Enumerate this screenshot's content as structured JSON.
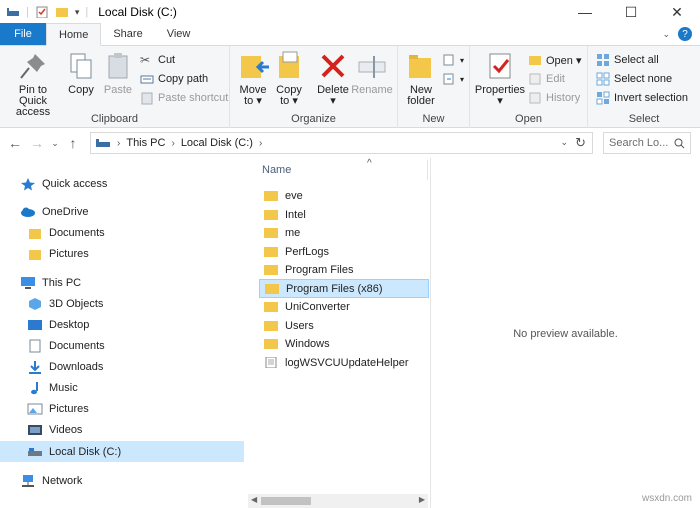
{
  "window": {
    "title": "Local Disk (C:)",
    "controls": {
      "minimize": "—",
      "maximize": "☐",
      "close": "✕"
    }
  },
  "tabs": {
    "file": "File",
    "home": "Home",
    "share": "Share",
    "view": "View"
  },
  "ribbon": {
    "clipboard": {
      "label": "Clipboard",
      "pin": [
        "Pin to Quick",
        "access"
      ],
      "copy": "Copy",
      "paste": "Paste",
      "cut": "Cut",
      "copy_path": "Copy path",
      "paste_shortcut": "Paste shortcut"
    },
    "organize": {
      "label": "Organize",
      "move_to": [
        "Move",
        "to ▾"
      ],
      "copy_to": [
        "Copy",
        "to ▾"
      ],
      "delete": [
        "Delete",
        "▾"
      ],
      "rename": "Rename"
    },
    "new": {
      "label": "New",
      "new_folder": [
        "New",
        "folder"
      ]
    },
    "open": {
      "label": "Open",
      "properties": [
        "Properties",
        "▾"
      ],
      "open": "Open ▾",
      "edit": "Edit",
      "history": "History"
    },
    "select": {
      "label": "Select",
      "select_all": "Select all",
      "select_none": "Select none",
      "invert_selection": "Invert selection"
    }
  },
  "address": {
    "crumbs": [
      "This PC",
      "Local Disk (C:)"
    ],
    "search_placeholder": "Search Lo..."
  },
  "nav_pane": {
    "items": [
      {
        "label": "Quick access",
        "icon": "star-icon"
      },
      {
        "label": "OneDrive",
        "icon": "cloud-icon"
      },
      {
        "label": "Documents",
        "icon": "folder-icon"
      },
      {
        "label": "Pictures",
        "icon": "folder-icon"
      },
      {
        "label": "This PC",
        "icon": "computer-icon"
      },
      {
        "label": "3D Objects",
        "icon": "cube-icon"
      },
      {
        "label": "Desktop",
        "icon": "desktop-icon"
      },
      {
        "label": "Documents",
        "icon": "documents-icon"
      },
      {
        "label": "Downloads",
        "icon": "download-icon"
      },
      {
        "label": "Music",
        "icon": "music-icon"
      },
      {
        "label": "Pictures",
        "icon": "pictures-icon"
      },
      {
        "label": "Videos",
        "icon": "videos-icon"
      },
      {
        "label": "Local Disk (C:)",
        "icon": "drive-icon"
      },
      {
        "label": "Network",
        "icon": "network-icon"
      }
    ]
  },
  "file_list": {
    "column_name": "Name",
    "files": [
      {
        "name": "eve",
        "type": "folder"
      },
      {
        "name": "Intel",
        "type": "folder"
      },
      {
        "name": "me",
        "type": "folder"
      },
      {
        "name": "PerfLogs",
        "type": "folder"
      },
      {
        "name": "Program Files",
        "type": "folder"
      },
      {
        "name": "Program Files (x86)",
        "type": "folder"
      },
      {
        "name": "UniConverter",
        "type": "folder"
      },
      {
        "name": "Users",
        "type": "folder"
      },
      {
        "name": "Windows",
        "type": "folder"
      },
      {
        "name": "logWSVCUUpdateHelper",
        "type": "file"
      }
    ]
  },
  "preview": {
    "text": "No preview available."
  },
  "watermark": "wsxdn.com",
  "colors": {
    "accent": "#1979ca",
    "selection": "#cce8ff",
    "folder": "#f3c74a"
  }
}
